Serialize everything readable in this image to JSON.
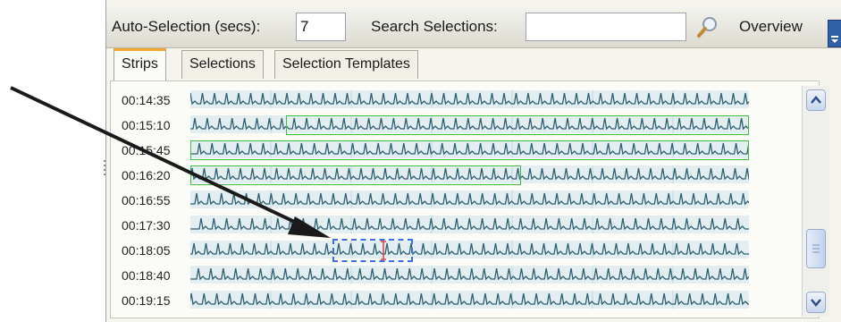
{
  "toolbar": {
    "auto_selection_label": "Auto-Selection (secs):",
    "auto_selection_value": "7",
    "search_label": "Search Selections:",
    "search_value": "",
    "overview_label": "Overview"
  },
  "tabs": [
    {
      "label": "Strips",
      "active": true
    },
    {
      "label": "Selections",
      "active": false
    },
    {
      "label": "Selection Templates",
      "active": false
    }
  ],
  "strips": [
    {
      "time": "00:14:35"
    },
    {
      "time": "00:15:10"
    },
    {
      "time": "00:15:45"
    },
    {
      "time": "00:16:20"
    },
    {
      "time": "00:16:55"
    },
    {
      "time": "00:17:30"
    },
    {
      "time": "00:18:05"
    },
    {
      "time": "00:18:40"
    },
    {
      "time": "00:19:15"
    }
  ],
  "colors": {
    "waveform": "#2e5f6e",
    "selection": "#3fbf3f",
    "active_selection": "#3b6fe0",
    "tab_accent": "#f0a830"
  },
  "icons": {
    "search": "search-icon",
    "scroll_up": "chevron-up-icon",
    "scroll_down": "chevron-down-icon",
    "arrow": "annotation-arrow-icon"
  }
}
